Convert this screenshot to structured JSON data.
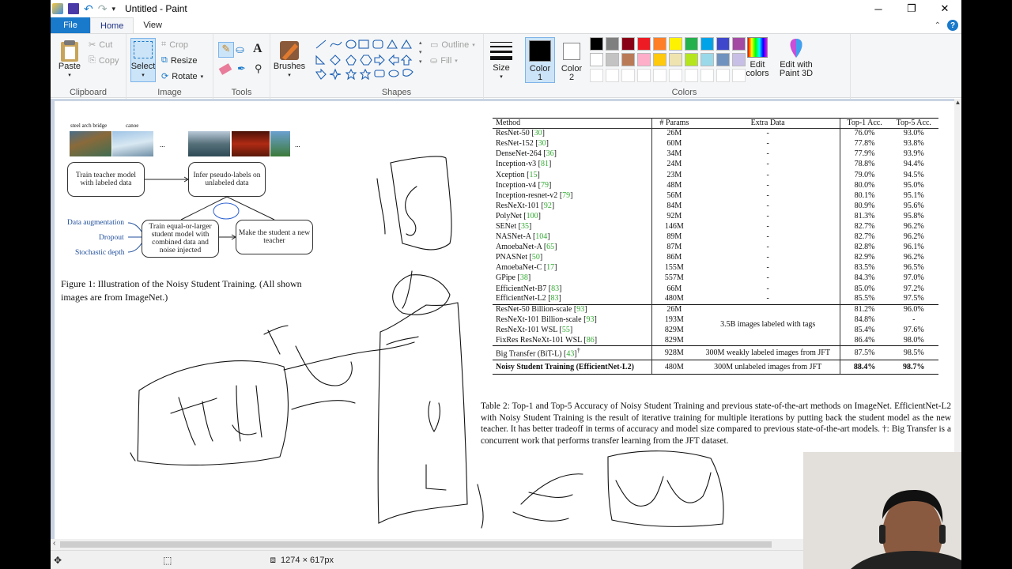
{
  "window": {
    "title": "Untitled - Paint"
  },
  "tabs": [
    "File",
    "Home",
    "View"
  ],
  "ribbon": {
    "clipboard": {
      "paste": "Paste",
      "cut": "Cut",
      "copy": "Copy",
      "label": "Clipboard"
    },
    "image": {
      "select": "Select",
      "crop": "Crop",
      "resize": "Resize",
      "rotate": "Rotate",
      "label": "Image"
    },
    "tools": {
      "label": "Tools"
    },
    "brushes": {
      "label": "Brushes"
    },
    "shapes": {
      "outline": "Outline",
      "fill": "Fill",
      "label": "Shapes"
    },
    "size": {
      "label": "Size"
    },
    "colors": {
      "color1": "Color 1",
      "color2": "Color 2",
      "edit_colors": "Edit colors",
      "edit3d": "Edit with Paint 3D",
      "label": "Colors",
      "palette_row1": [
        "#000000",
        "#7f7f7f",
        "#880015",
        "#ed1c24",
        "#ff7f27",
        "#fff200",
        "#22b14c",
        "#00a2e8",
        "#3f48cc",
        "#a349a4"
      ],
      "palette_row2": [
        "#ffffff",
        "#c3c3c3",
        "#b97a57",
        "#ffaec9",
        "#ffc90e",
        "#efe4b0",
        "#b5e61d",
        "#99d9ea",
        "#7092be",
        "#c8bfe7"
      ]
    }
  },
  "figure": {
    "img_label1": "steel arch bridge",
    "img_label2": "canoe",
    "ellipsis": "...",
    "box_teacher": "Train teacher model with labeled data",
    "box_infer": "Infer pseudo-labels on unlabeled data",
    "box_student": "Train equal-or-larger student model with combined data and noise injected",
    "box_make": "Make the student a new teacher",
    "side1": "Data augmentation",
    "side2": "Dropout",
    "side3": "Stochastic depth",
    "caption": "Figure 1: Illustration of the Noisy Student Training. (All shown images are from ImageNet.)"
  },
  "table": {
    "headers": [
      "Method",
      "# Params",
      "Extra Data",
      "Top-1 Acc.",
      "Top-5 Acc."
    ],
    "group1": [
      [
        "ResNet-50",
        "30",
        "26M",
        "-",
        "76.0%",
        "93.0%"
      ],
      [
        "ResNet-152",
        "30",
        "60M",
        "-",
        "77.8%",
        "93.8%"
      ],
      [
        "DenseNet-264",
        "36",
        "34M",
        "-",
        "77.9%",
        "93.9%"
      ],
      [
        "Inception-v3",
        "81",
        "24M",
        "-",
        "78.8%",
        "94.4%"
      ],
      [
        "Xception",
        "15",
        "23M",
        "-",
        "79.0%",
        "94.5%"
      ],
      [
        "Inception-v4",
        "79",
        "48M",
        "-",
        "80.0%",
        "95.0%"
      ],
      [
        "Inception-resnet-v2",
        "79",
        "56M",
        "-",
        "80.1%",
        "95.1%"
      ],
      [
        "ResNeXt-101",
        "92",
        "84M",
        "-",
        "80.9%",
        "95.6%"
      ],
      [
        "PolyNet",
        "100",
        "92M",
        "-",
        "81.3%",
        "95.8%"
      ],
      [
        "SENet",
        "35",
        "146M",
        "-",
        "82.7%",
        "96.2%"
      ],
      [
        "NASNet-A",
        "104",
        "89M",
        "-",
        "82.7%",
        "96.2%"
      ],
      [
        "AmoebaNet-A",
        "65",
        "87M",
        "-",
        "82.8%",
        "96.1%"
      ],
      [
        "PNASNet",
        "50",
        "86M",
        "-",
        "82.9%",
        "96.2%"
      ],
      [
        "AmoebaNet-C",
        "17",
        "155M",
        "-",
        "83.5%",
        "96.5%"
      ],
      [
        "GPipe",
        "38",
        "557M",
        "-",
        "84.3%",
        "97.0%"
      ],
      [
        "EfficientNet-B7",
        "83",
        "66M",
        "-",
        "85.0%",
        "97.2%"
      ],
      [
        "EfficientNet-L2",
        "83",
        "480M",
        "-",
        "85.5%",
        "97.5%"
      ]
    ],
    "group2": [
      [
        "ResNet-50 Billion-scale",
        "93",
        "26M",
        "81.2%",
        "96.0%"
      ],
      [
        "ResNeXt-101 Billion-scale",
        "93",
        "193M",
        "84.8%",
        "-"
      ],
      [
        "ResNeXt-101 WSL",
        "55",
        "829M",
        "85.4%",
        "97.6%"
      ],
      [
        "FixRes ResNeXt-101 WSL",
        "86",
        "829M",
        "86.4%",
        "98.0%"
      ]
    ],
    "group2_extra": "3.5B images labeled with tags",
    "bit": [
      "Big Transfer (BiT-L)",
      "43",
      "928M",
      "300M weakly labeled images from JFT",
      "87.5%",
      "98.5%"
    ],
    "bit_dagger": "†",
    "noisy": [
      "Noisy Student Training (EfficientNet-L2)",
      "480M",
      "300M unlabeled images from JFT",
      "88.4%",
      "98.7%"
    ],
    "caption": "Table 2: Top-1 and Top-5 Accuracy of Noisy Student Training and previous state-of-the-art methods on ImageNet. EfficientNet-L2 with Noisy Student Training is the result of iterative training for multiple iterations by putting back the student model as the new teacher. It has better tradeoff in terms of accuracy and model size compared to previous state-of-the-art models. †: Big Transfer is a concurrent work that performs transfer learning from the JFT dataset."
  },
  "status": {
    "size": "1274 × 617px"
  }
}
